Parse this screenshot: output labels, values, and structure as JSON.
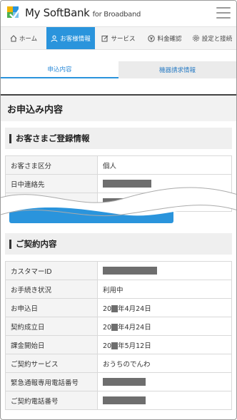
{
  "header": {
    "logo_text": "My SoftBank",
    "logo_sub": "for Broadband",
    "menu_icon": "hamburger-icon"
  },
  "nav": {
    "items": [
      {
        "label": "ホーム",
        "icon": "home-icon",
        "active": false
      },
      {
        "label": "お客様情報",
        "icon": "user-icon",
        "active": true
      },
      {
        "label": "サービス",
        "icon": "edit-icon",
        "active": false
      },
      {
        "label": "料金確認",
        "icon": "yen-icon",
        "active": false
      },
      {
        "label": "設定と接続",
        "icon": "gear-icon",
        "active": false
      }
    ]
  },
  "subtabs": [
    {
      "label": "申込内容",
      "active": true
    },
    {
      "label": "機器請求情報",
      "active": false
    }
  ],
  "page_title": "お申込み内容",
  "registration": {
    "title": "お客さまご登録情報",
    "rows": [
      {
        "label": "お客さま区分",
        "value": "個人"
      },
      {
        "label": "日中連絡先",
        "value": ""
      }
    ]
  },
  "contract": {
    "title": "ご契約内容",
    "rows": [
      {
        "label": "カスタマーID",
        "value": ""
      },
      {
        "label": "お手続き状況",
        "value": "利用中"
      },
      {
        "label": "お申込日",
        "prefix": "20",
        "value": "年4月24日"
      },
      {
        "label": "契約成立日",
        "prefix": "20",
        "value": "年4月24日"
      },
      {
        "label": "課金開始日",
        "prefix": "20",
        "value": "年5月12日"
      },
      {
        "label": "ご契約サービス",
        "value": "おうちのでんわ"
      },
      {
        "label": "緊急通報専用電話番号",
        "value": ""
      },
      {
        "label": "ご契約電話番号",
        "value": ""
      }
    ]
  },
  "colors": {
    "accent": "#2a94dc",
    "mask": "#6e6e6e"
  }
}
